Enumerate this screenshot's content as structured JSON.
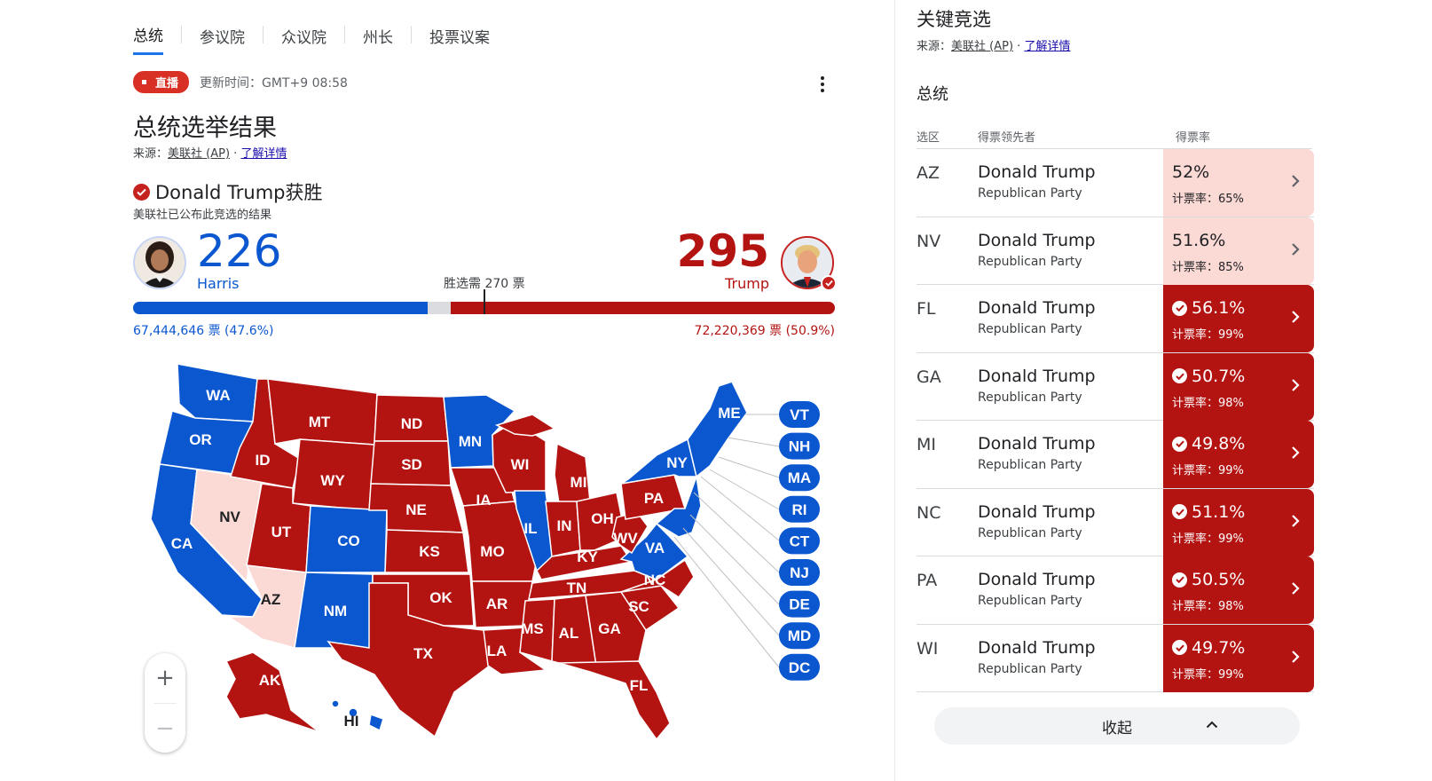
{
  "tabs": [
    "总统",
    "参议院",
    "众议院",
    "州长",
    "投票议案"
  ],
  "live": {
    "badge": "直播",
    "update": "更新时间：GMT+9 08:58"
  },
  "title": "总统选举结果",
  "source": {
    "prefix": "来源：",
    "name": "美联社 (AP)",
    "sep": " · ",
    "link": "了解详情"
  },
  "winner": {
    "text": "Donald Trump获胜",
    "sub": "美联社已公布此竞选的结果"
  },
  "harris": {
    "ev": "226",
    "name": "Harris",
    "popular": "67,444,646 票 (47.6%)",
    "ev_share": 0.42
  },
  "trump": {
    "ev": "295",
    "name": "Trump",
    "popular": "72,220,369 票 (50.9%)",
    "ev_share": 0.548
  },
  "needed": "胜选需 270 票",
  "map": {
    "colors": {
      "dem": "#0b57d0",
      "rep": "#b31412",
      "lean_rep": "#fbd9d5"
    },
    "state_labels": {
      "WA": "WA",
      "OR": "OR",
      "CA": "CA",
      "ID": "ID",
      "NV": "NV",
      "AZ": "AZ",
      "UT": "UT",
      "MT": "MT",
      "WY": "WY",
      "CO": "CO",
      "NM": "NM",
      "ND": "ND",
      "SD": "SD",
      "NE": "NE",
      "KS": "KS",
      "OK": "OK",
      "TX": "TX",
      "MN": "MN",
      "IA": "IA",
      "MO": "MO",
      "AR": "AR",
      "LA": "LA",
      "WI": "WI",
      "IL": "IL",
      "MI": "MI",
      "IN": "IN",
      "OH": "OH",
      "KY": "KY",
      "TN": "TN",
      "MS": "MS",
      "AL": "AL",
      "GA": "GA",
      "FL": "FL",
      "SC": "SC",
      "NC": "NC",
      "VA": "VA",
      "WV": "WV",
      "PA": "PA",
      "NY": "NY",
      "ME": "ME",
      "AK": "AK",
      "HI": "HI"
    },
    "small_states": [
      "VT",
      "NH",
      "MA",
      "RI",
      "CT",
      "NJ",
      "DE",
      "MD",
      "DC"
    ]
  },
  "zoom": {
    "in": "+",
    "out": "−"
  },
  "key_races": {
    "title": "关键竞选",
    "source_prefix": "来源：",
    "source_name": "美联社 (AP)",
    "source_sep": " · ",
    "source_link": "了解详情",
    "section": "总统",
    "headers": {
      "state": "选区",
      "leader": "得票领先者",
      "rate": "得票率"
    },
    "rows": [
      {
        "state": "AZ",
        "candidate": "Donald Trump",
        "party": "Republican Party",
        "pct": "52%",
        "counted": "计票率：65%",
        "called": false
      },
      {
        "state": "NV",
        "candidate": "Donald Trump",
        "party": "Republican Party",
        "pct": "51.6%",
        "counted": "计票率：85%",
        "called": false
      },
      {
        "state": "FL",
        "candidate": "Donald Trump",
        "party": "Republican Party",
        "pct": "56.1%",
        "counted": "计票率：99%",
        "called": true
      },
      {
        "state": "GA",
        "candidate": "Donald Trump",
        "party": "Republican Party",
        "pct": "50.7%",
        "counted": "计票率：98%",
        "called": true
      },
      {
        "state": "MI",
        "candidate": "Donald Trump",
        "party": "Republican Party",
        "pct": "49.8%",
        "counted": "计票率：99%",
        "called": true
      },
      {
        "state": "NC",
        "candidate": "Donald Trump",
        "party": "Republican Party",
        "pct": "51.1%",
        "counted": "计票率：99%",
        "called": true
      },
      {
        "state": "PA",
        "candidate": "Donald Trump",
        "party": "Republican Party",
        "pct": "50.5%",
        "counted": "计票率：98%",
        "called": true
      },
      {
        "state": "WI",
        "candidate": "Donald Trump",
        "party": "Republican Party",
        "pct": "49.7%",
        "counted": "计票率：99%",
        "called": true
      }
    ],
    "collapse": "收起"
  }
}
